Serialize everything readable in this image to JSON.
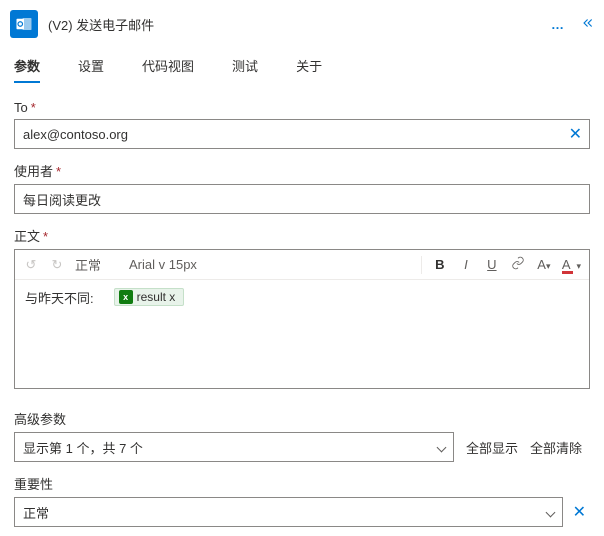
{
  "header": {
    "title": "(V2) 发送电子邮件"
  },
  "tabs": {
    "items": [
      "参数",
      "设置",
      "代码视图",
      "测试",
      "关于"
    ],
    "activeIndex": 0
  },
  "fields": {
    "to": {
      "label": "To",
      "value": "alex@contoso.org"
    },
    "subject": {
      "label": "使用者",
      "value": "每日阅读更改"
    },
    "body": {
      "label": "正文",
      "toolbar": {
        "styleLabel": "正常",
        "fontLabel": "Arial v 15px",
        "boldLabel": "B",
        "italicLabel": "I",
        "underlineLabel": "U",
        "fontColorLabel": "A",
        "highlightLabel": "A"
      },
      "contentPrefix": "与昨天不同:",
      "tokenLabel": "result x"
    },
    "advanced": {
      "label": "高级参数",
      "selectText": "显示第 1 个，共 7 个",
      "showAll": "全部显示",
      "clearAll": "全部清除"
    },
    "importance": {
      "label": "重要性",
      "value": "正常"
    }
  }
}
